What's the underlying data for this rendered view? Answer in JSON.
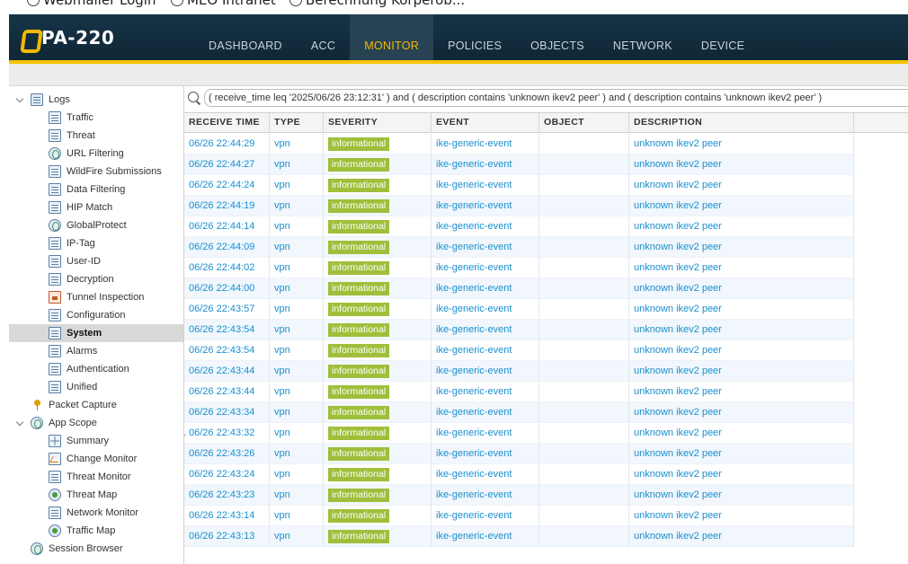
{
  "browser": {
    "bookmarks": [
      {
        "label": "Webmailer Login",
        "icon": "globe-icon"
      },
      {
        "label": "MEO Intranet",
        "icon": "globe-icon"
      },
      {
        "label": "Berechnung Körperob...",
        "icon": "globe-icon"
      }
    ]
  },
  "app": {
    "product": "PA-220",
    "accent_color": "#f5c400",
    "nav": [
      {
        "label": "DASHBOARD",
        "active": false
      },
      {
        "label": "ACC",
        "active": false
      },
      {
        "label": "MONITOR",
        "active": true
      },
      {
        "label": "POLICIES",
        "active": false
      },
      {
        "label": "OBJECTS",
        "active": false
      },
      {
        "label": "NETWORK",
        "active": false
      },
      {
        "label": "DEVICE",
        "active": false
      }
    ]
  },
  "sidebar": {
    "items": [
      {
        "label": "Logs",
        "level": 0,
        "expanded": true,
        "icon": "folder-icon"
      },
      {
        "label": "Traffic",
        "level": 1,
        "icon": "log-icon"
      },
      {
        "label": "Threat",
        "level": 1,
        "icon": "log-icon"
      },
      {
        "label": "URL Filtering",
        "level": 1,
        "icon": "globe-icon"
      },
      {
        "label": "WildFire Submissions",
        "level": 1,
        "icon": "log-icon"
      },
      {
        "label": "Data Filtering",
        "level": 1,
        "icon": "log-icon"
      },
      {
        "label": "HIP Match",
        "level": 1,
        "icon": "log-icon"
      },
      {
        "label": "GlobalProtect",
        "level": 1,
        "icon": "globe-icon"
      },
      {
        "label": "IP-Tag",
        "level": 1,
        "icon": "log-icon"
      },
      {
        "label": "User-ID",
        "level": 1,
        "icon": "log-icon"
      },
      {
        "label": "Decryption",
        "level": 1,
        "icon": "log-icon"
      },
      {
        "label": "Tunnel Inspection",
        "level": 1,
        "icon": "lock-icon"
      },
      {
        "label": "Configuration",
        "level": 1,
        "icon": "log-icon"
      },
      {
        "label": "System",
        "level": 1,
        "icon": "log-icon",
        "selected": true
      },
      {
        "label": "Alarms",
        "level": 1,
        "icon": "log-icon"
      },
      {
        "label": "Authentication",
        "level": 1,
        "icon": "log-icon"
      },
      {
        "label": "Unified",
        "level": 1,
        "icon": "log-icon"
      },
      {
        "label": "Packet Capture",
        "level": 0,
        "icon": "pin-icon"
      },
      {
        "label": "App Scope",
        "level": 0,
        "expanded": true,
        "icon": "globe-icon"
      },
      {
        "label": "Summary",
        "level": 1,
        "icon": "grid-icon"
      },
      {
        "label": "Change Monitor",
        "level": 1,
        "icon": "wave-icon"
      },
      {
        "label": "Threat Monitor",
        "level": 1,
        "icon": "log-icon"
      },
      {
        "label": "Threat Map",
        "level": 1,
        "icon": "map-icon"
      },
      {
        "label": "Network Monitor",
        "level": 1,
        "icon": "log-icon"
      },
      {
        "label": "Traffic Map",
        "level": 1,
        "icon": "map-icon"
      },
      {
        "label": "Session Browser",
        "level": 0,
        "icon": "globe-icon"
      }
    ]
  },
  "filter": {
    "query": "( receive_time leq '2025/06/26 23:12:31' ) and ( description contains 'unknown ikev2 peer' ) and ( description contains 'unknown ikev2 peer' )"
  },
  "table": {
    "columns": [
      "RECEIVE TIME",
      "TYPE",
      "SEVERITY",
      "EVENT",
      "OBJECT",
      "DESCRIPTION"
    ],
    "severity_color": "#9fbf3a",
    "rows": [
      [
        "06/26 22:44:29",
        "vpn",
        "informational",
        "ike-generic-event",
        "",
        "unknown ikev2 peer"
      ],
      [
        "06/26 22:44:27",
        "vpn",
        "informational",
        "ike-generic-event",
        "",
        "unknown ikev2 peer"
      ],
      [
        "06/26 22:44:24",
        "vpn",
        "informational",
        "ike-generic-event",
        "",
        "unknown ikev2 peer"
      ],
      [
        "06/26 22:44:19",
        "vpn",
        "informational",
        "ike-generic-event",
        "",
        "unknown ikev2 peer"
      ],
      [
        "06/26 22:44:14",
        "vpn",
        "informational",
        "ike-generic-event",
        "",
        "unknown ikev2 peer"
      ],
      [
        "06/26 22:44:09",
        "vpn",
        "informational",
        "ike-generic-event",
        "",
        "unknown ikev2 peer"
      ],
      [
        "06/26 22:44:02",
        "vpn",
        "informational",
        "ike-generic-event",
        "",
        "unknown ikev2 peer"
      ],
      [
        "06/26 22:44:00",
        "vpn",
        "informational",
        "ike-generic-event",
        "",
        "unknown ikev2 peer"
      ],
      [
        "06/26 22:43:57",
        "vpn",
        "informational",
        "ike-generic-event",
        "",
        "unknown ikev2 peer"
      ],
      [
        "06/26 22:43:54",
        "vpn",
        "informational",
        "ike-generic-event",
        "",
        "unknown ikev2 peer"
      ],
      [
        "06/26 22:43:54",
        "vpn",
        "informational",
        "ike-generic-event",
        "",
        "unknown ikev2 peer"
      ],
      [
        "06/26 22:43:44",
        "vpn",
        "informational",
        "ike-generic-event",
        "",
        "unknown ikev2 peer"
      ],
      [
        "06/26 22:43:44",
        "vpn",
        "informational",
        "ike-generic-event",
        "",
        "unknown ikev2 peer"
      ],
      [
        "06/26 22:43:34",
        "vpn",
        "informational",
        "ike-generic-event",
        "",
        "unknown ikev2 peer"
      ],
      [
        "06/26 22:43:32",
        "vpn",
        "informational",
        "ike-generic-event",
        "",
        "unknown ikev2 peer"
      ],
      [
        "06/26 22:43:26",
        "vpn",
        "informational",
        "ike-generic-event",
        "",
        "unknown ikev2 peer"
      ],
      [
        "06/26 22:43:24",
        "vpn",
        "informational",
        "ike-generic-event",
        "",
        "unknown ikev2 peer"
      ],
      [
        "06/26 22:43:23",
        "vpn",
        "informational",
        "ike-generic-event",
        "",
        "unknown ikev2 peer"
      ],
      [
        "06/26 22:43:14",
        "vpn",
        "informational",
        "ike-generic-event",
        "",
        "unknown ikev2 peer"
      ],
      [
        "06/26 22:43:13",
        "vpn",
        "informational",
        "ike-generic-event",
        "",
        "unknown ikev2 peer"
      ]
    ]
  }
}
